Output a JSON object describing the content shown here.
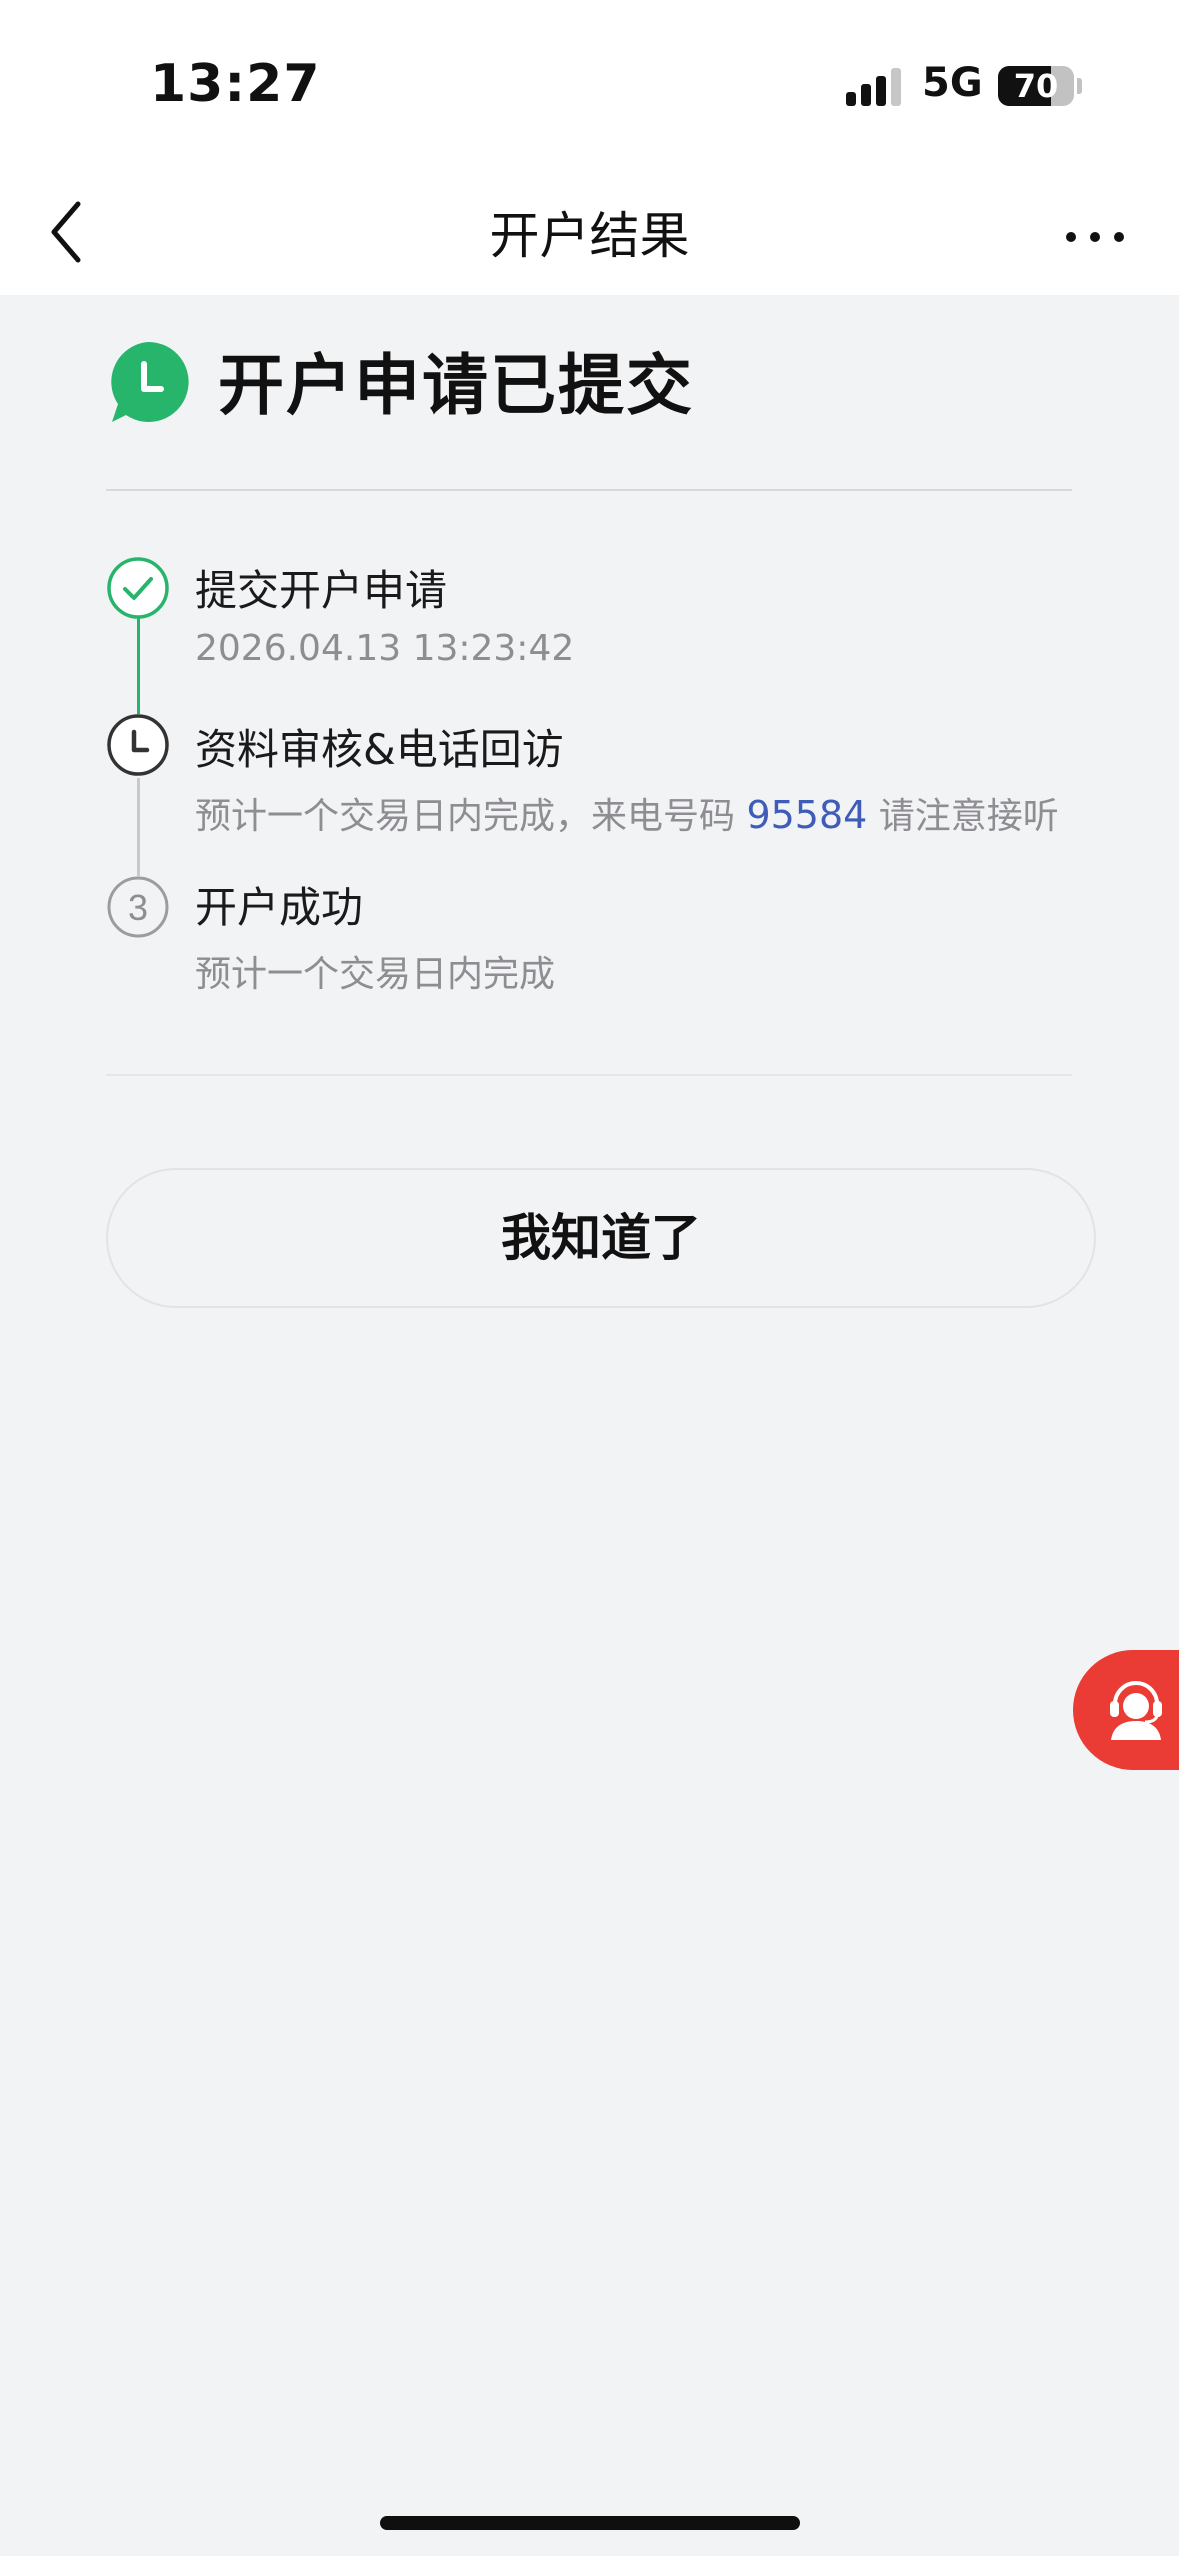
{
  "status_bar": {
    "time": "13:27",
    "network": "5G",
    "battery": "70",
    "battery_level_percent": 70
  },
  "nav": {
    "title": "开户结果",
    "back_icon": "chevron-left-icon",
    "more_icon": "more-horizontal-icon"
  },
  "result": {
    "title": "开户申请已提交",
    "icon": "clock-chat-bubble-icon",
    "accent_color": "#27b56b"
  },
  "steps": [
    {
      "title": "提交开户申请",
      "desc": "2026.04.13 13:23:42",
      "state": "done",
      "icon": "check-circle-icon"
    },
    {
      "title": "资料审核&电话回访",
      "desc_before": "预计一个交易日内完成，来电号码 ",
      "phone": "95584",
      "desc_after": " 请注意接听",
      "state": "in-progress",
      "icon": "clock-icon"
    },
    {
      "title": "开户成功",
      "desc": "预计一个交易日内完成",
      "state": "pending",
      "number": "3"
    }
  ],
  "actions": {
    "ack_label": "我知道了"
  },
  "fab": {
    "icon": "customer-service-icon",
    "color": "#ea3b34"
  }
}
